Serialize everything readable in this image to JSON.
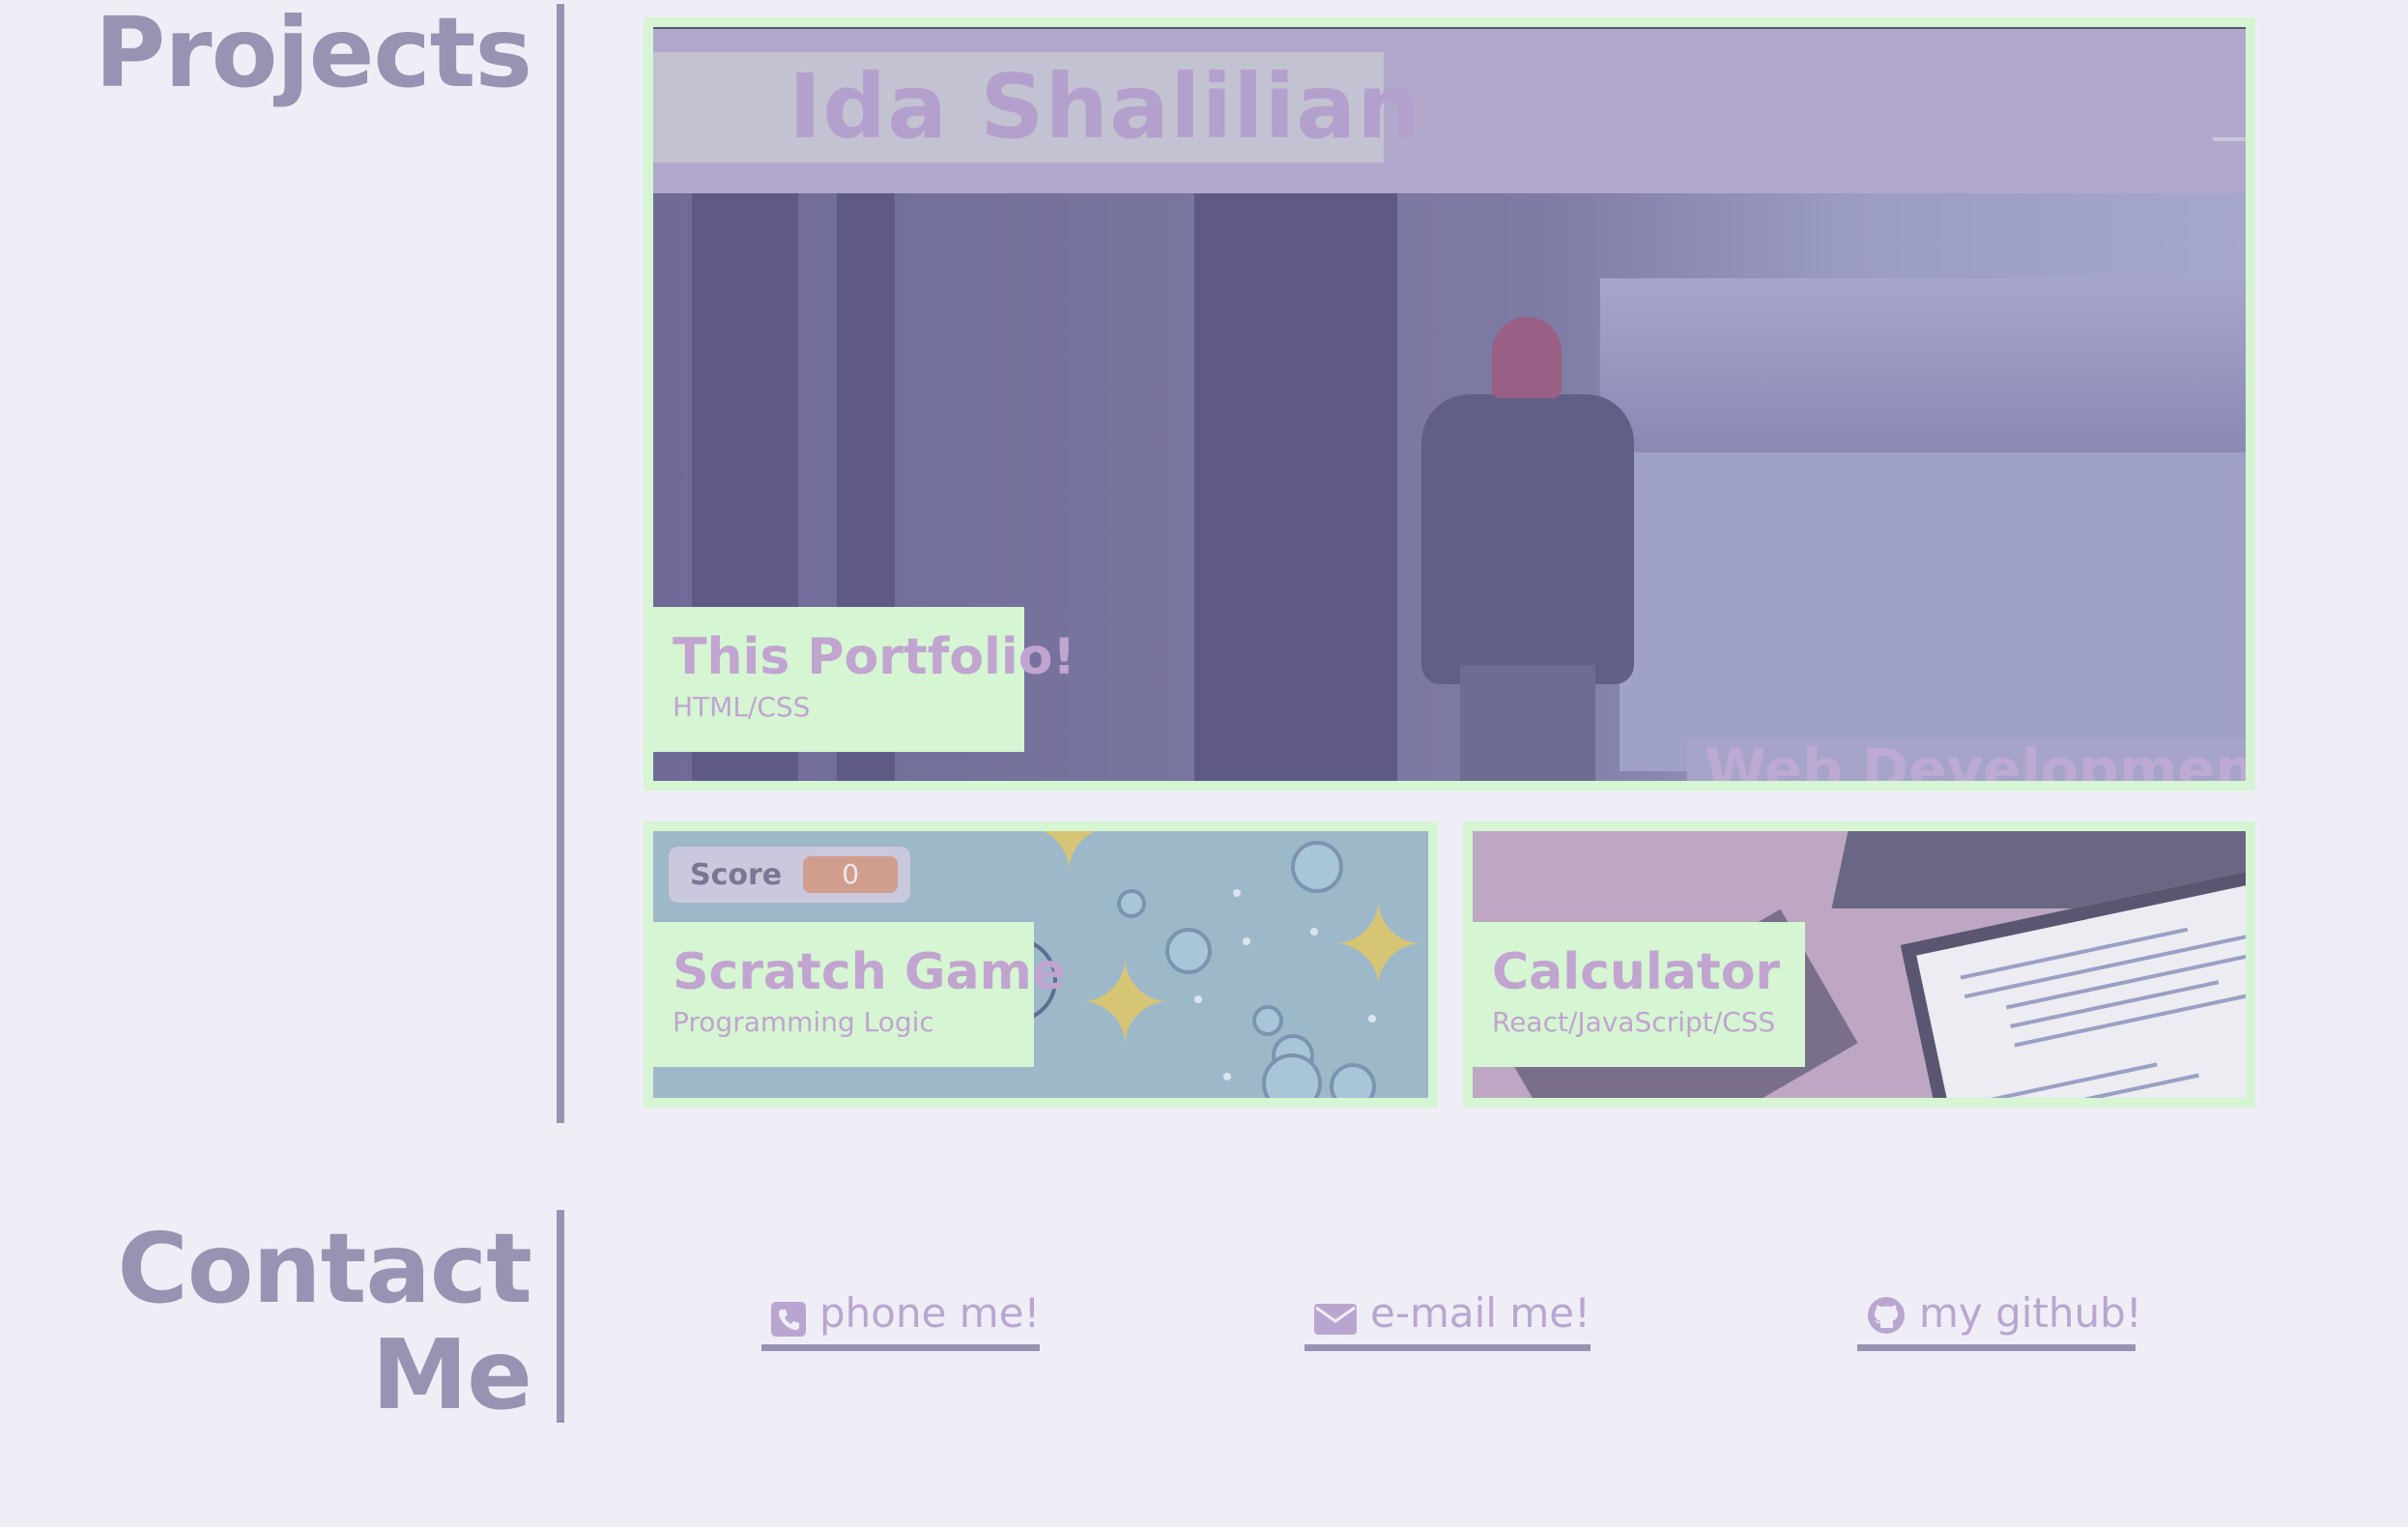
{
  "sections": {
    "projects_title": "Projects",
    "contact_title_line1": "Contact",
    "contact_title_line2": "Me"
  },
  "projects": [
    {
      "title": "This Portfolio!",
      "tech": "HTML/CSS",
      "preview_name": "Ida Shalilian",
      "preview_tagline": "Web Development an"
    },
    {
      "title": "Scratch Game",
      "tech": "Programming Logic",
      "score_label": "Score",
      "score_value": "0"
    },
    {
      "title": "Calculator",
      "tech": "React/JavaScript/CSS"
    }
  ],
  "contact": {
    "phone_label": "phone me!",
    "email_label": "e-mail me!",
    "github_label": "my github!"
  },
  "icons": {
    "phone": "phone-square-icon",
    "email": "envelope-icon",
    "github": "github-icon"
  },
  "colors": {
    "background": "#efeef6",
    "accent_text": "#9892b3",
    "card_border": "#d5f5d3",
    "link_text": "#b9a6d0"
  }
}
